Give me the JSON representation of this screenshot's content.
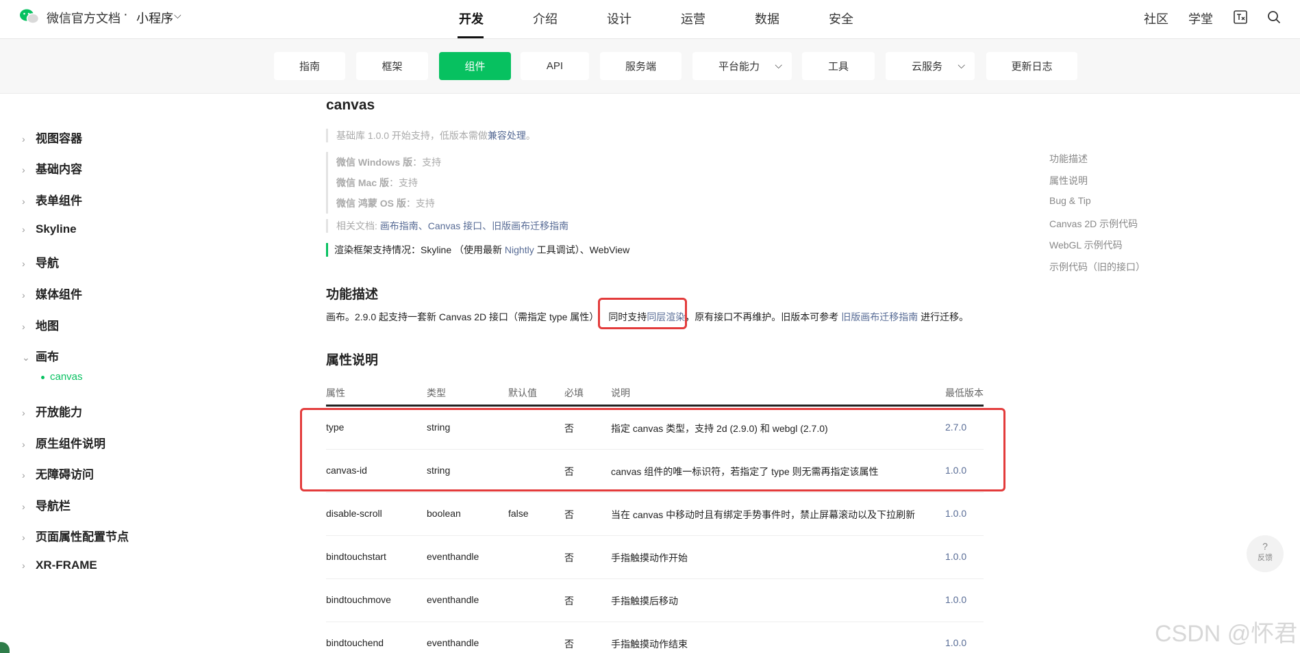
{
  "topbar": {
    "brand": "微信官方文档",
    "dot": "·",
    "product": "小程序",
    "nav": [
      "开发",
      "介绍",
      "设计",
      "运营",
      "数据",
      "安全"
    ],
    "right": [
      "社区",
      "学堂"
    ]
  },
  "subnav": {
    "items": [
      "指南",
      "框架",
      "组件",
      "API",
      "服务端",
      "平台能力",
      "工具",
      "云服务",
      "更新日志"
    ],
    "active": "组件"
  },
  "sidebar": {
    "items": [
      "视图容器",
      "基础内容",
      "表单组件",
      "Skyline",
      "导航",
      "媒体组件",
      "地图",
      "画布",
      "开放能力",
      "原生组件说明",
      "无障碍访问",
      "导航栏",
      "页面属性配置节点",
      "XR-FRAME"
    ],
    "sub_item": "canvas"
  },
  "main": {
    "title": "canvas",
    "support_note_prefix": "基础库 1.0.0 开始支持，低版本需做",
    "support_note_link": "兼容处理",
    "support_note_suffix": "。",
    "platforms": [
      {
        "name": "微信 Windows 版",
        "value": "：支持"
      },
      {
        "name": "微信 Mac 版",
        "value": "：支持"
      },
      {
        "name": "微信 鸿蒙 OS 版",
        "value": "：支持"
      }
    ],
    "related_prefix": "相关文档: ",
    "related_links": "画布指南、Canvas 接口、旧版画布迁移指南",
    "render_prefix": "渲染框架支持情况：Skyline （使用最新 ",
    "render_link": "Nightly",
    "render_suffix": " 工具调试）、WebView",
    "section_func": "功能描述",
    "func_text_1": "画布。2.9.0 起支持一套新 Canvas 2D 接口（需指定 type 属性）",
    "func_text_2": "同时支持",
    "func_link_1": "同层渲染",
    "func_text_3": "，原有接口不再维护。旧版本可参考 ",
    "func_link_2": "旧版画布迁移指南",
    "func_text_4": " 进行迁移。",
    "section_props": "属性说明",
    "table": {
      "headers": [
        "属性",
        "类型",
        "默认值",
        "必填",
        "说明",
        "最低版本"
      ],
      "rows": [
        [
          "type",
          "string",
          "",
          "否",
          "指定 canvas 类型，支持 2d (2.9.0) 和 webgl (2.7.0)",
          "2.7.0"
        ],
        [
          "canvas-id",
          "string",
          "",
          "否",
          "canvas 组件的唯一标识符，若指定了 type 则无需再指定该属性",
          "1.0.0"
        ],
        [
          "disable-scroll",
          "boolean",
          "false",
          "否",
          "当在 canvas 中移动时且有绑定手势事件时，禁止屏幕滚动以及下拉刷新",
          "1.0.0"
        ],
        [
          "bindtouchstart",
          "eventhandle",
          "",
          "否",
          "手指触摸动作开始",
          "1.0.0"
        ],
        [
          "bindtouchmove",
          "eventhandle",
          "",
          "否",
          "手指触摸后移动",
          "1.0.0"
        ],
        [
          "bindtouchend",
          "eventhandle",
          "",
          "否",
          "手指触摸动作结束",
          "1.0.0"
        ]
      ]
    }
  },
  "toc": [
    "功能描述",
    "属性说明",
    "Bug & Tip",
    "Canvas 2D 示例代码",
    "WebGL 示例代码",
    "示例代码（旧的接口）"
  ],
  "feedback": {
    "icon": "?",
    "label": "反馈"
  },
  "watermark": "CSDN @怀君",
  "colors": {
    "accent": "#07c160",
    "link": "#576b95",
    "highlight": "#e33b3b"
  }
}
